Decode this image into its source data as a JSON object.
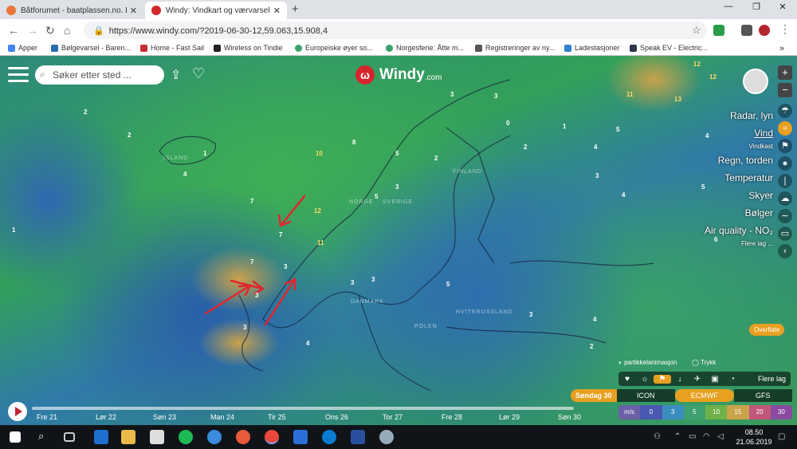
{
  "browser": {
    "tabs": [
      {
        "title": "Båtforumet - baatplassen.no. Din..."
      },
      {
        "title": "Windy: Vindkart og værvarsel"
      }
    ],
    "url": "https://www.windy.com/?2019-06-30-12,59.063,15.908,4",
    "bookmarks": [
      "Apper",
      "Bølgevarsel - Baren...",
      "Home - Fast Sail",
      "Wireless on Tindie",
      "Europeiske øyer so...",
      "Norgesferie: Åtte m...",
      "Registreringer av ny...",
      "Ladestasjoner",
      "Speak EV - Electric..."
    ]
  },
  "windy": {
    "search_placeholder": "Søker etter sted ...",
    "logo": "Windy",
    "logo_domain": ".com",
    "layers": [
      {
        "label": "Radar, lyn"
      },
      {
        "label": "Vind",
        "selected": true
      },
      {
        "label": "Vindkast",
        "small": true
      },
      {
        "label": "Regn, torden"
      },
      {
        "label": "Temperatur"
      },
      {
        "label": "Skyer"
      },
      {
        "label": "Bølger"
      },
      {
        "label": "Air quality - NO₂"
      },
      {
        "label": "Flere lag ...",
        "small": true
      }
    ],
    "overflate": "Overflate",
    "particle_label": "partikkelanimasjon",
    "pressure_label": "Trykk",
    "more_layers": "Flere lag",
    "date_label": "Søndag 30",
    "models": [
      "ICON",
      "ECMWF",
      "GFS"
    ],
    "scale": {
      "unit": "m/s",
      "values": [
        "0",
        "3",
        "5",
        "10",
        "15",
        "20",
        "30"
      ]
    },
    "timeline_days": [
      "Fre 21",
      "Lør 22",
      "Søn 23",
      "Man 24",
      "Tir 25",
      "Ons 26",
      "Tor 27",
      "Fre 28",
      "Lør 29",
      "Søn 30"
    ],
    "map_labels": [
      "ISLAND",
      "NORGE",
      "SVERIGE",
      "FINLAND",
      "POLEN",
      "HVITERUSSLAND",
      "DANMARK"
    ],
    "wind_values": [
      {
        "v": "2"
      },
      {
        "v": "2"
      },
      {
        "v": "1"
      },
      {
        "v": "1"
      },
      {
        "v": "4"
      },
      {
        "v": "10"
      },
      {
        "v": "8"
      },
      {
        "v": "7"
      },
      {
        "v": "12"
      },
      {
        "v": "7"
      },
      {
        "v": "11"
      },
      {
        "v": "7"
      },
      {
        "v": "3"
      },
      {
        "v": "3"
      },
      {
        "v": "3"
      },
      {
        "v": "5"
      },
      {
        "v": "3"
      },
      {
        "v": "2"
      },
      {
        "v": "5"
      },
      {
        "v": "3"
      },
      {
        "v": "4"
      },
      {
        "v": "5"
      },
      {
        "v": "4"
      },
      {
        "v": "3"
      },
      {
        "v": "2"
      },
      {
        "v": "0"
      },
      {
        "v": "1"
      },
      {
        "v": "3"
      },
      {
        "v": "4"
      },
      {
        "v": "5"
      },
      {
        "v": "6"
      },
      {
        "v": "12"
      },
      {
        "v": "13"
      },
      {
        "v": "11"
      },
      {
        "v": "12"
      },
      {
        "v": "3"
      },
      {
        "v": "4"
      },
      {
        "v": "3"
      },
      {
        "v": "5"
      },
      {
        "v": "3"
      },
      {
        "v": "4"
      },
      {
        "v": "2"
      }
    ]
  },
  "taskbar": {
    "time": "08.50",
    "date": "21.06.2019"
  }
}
